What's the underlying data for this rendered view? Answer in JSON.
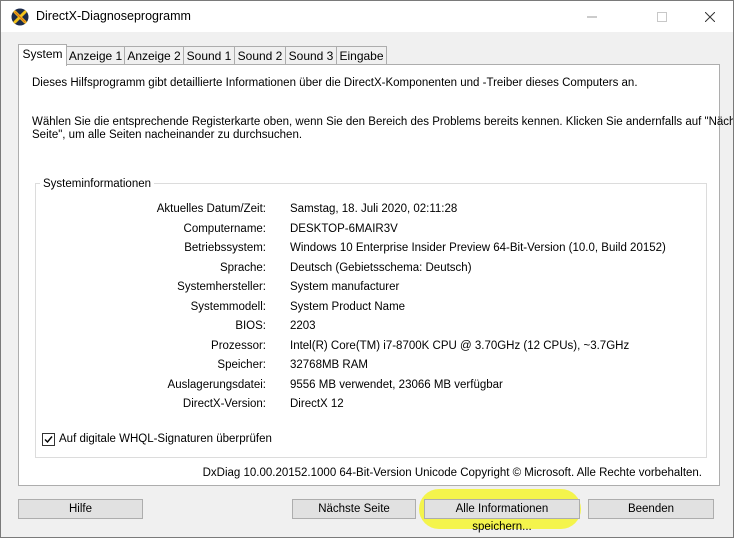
{
  "window": {
    "title": "DirectX-Diagnoseprogramm",
    "minimize_glyph": "—",
    "maximize_glyph": "☐",
    "close_glyph": "✕",
    "icon": "directx-icon"
  },
  "tabs": [
    {
      "label": "System",
      "active": true
    },
    {
      "label": "Anzeige 1"
    },
    {
      "label": "Anzeige 2"
    },
    {
      "label": "Sound 1"
    },
    {
      "label": "Sound 2"
    },
    {
      "label": "Sound 3"
    },
    {
      "label": "Eingabe"
    }
  ],
  "intro": {
    "line1": "Dieses Hilfsprogramm gibt detaillierte Informationen über die DirectX-Komponenten und -Treiber dieses Computers an.",
    "line2": "Wählen Sie die entsprechende Registerkarte oben, wenn Sie den Bereich des Problems bereits kennen. Klicken Sie andernfalls auf \"Nächste",
    "line3": "Seite\", um alle Seiten nacheinander zu durchsuchen."
  },
  "sysinfo": {
    "title": "Systeminformationen",
    "rows": [
      {
        "label": "Aktuelles Datum/Zeit:",
        "value": "Samstag, 18. Juli 2020, 02:11:28"
      },
      {
        "label": "Computername:",
        "value": "DESKTOP-6MAIR3V"
      },
      {
        "label": "Betriebssystem:",
        "value": "Windows 10 Enterprise Insider Preview 64-Bit-Version (10.0, Build 20152)"
      },
      {
        "label": "Sprache:",
        "value": "Deutsch (Gebietsschema: Deutsch)"
      },
      {
        "label": "Systemhersteller:",
        "value": "System manufacturer"
      },
      {
        "label": "Systemmodell:",
        "value": "System Product Name"
      },
      {
        "label": "BIOS:",
        "value": "2203"
      },
      {
        "label": "Prozessor:",
        "value": "Intel(R) Core(TM) i7-8700K CPU @ 3.70GHz (12 CPUs), ~3.7GHz"
      },
      {
        "label": "Speicher:",
        "value": "32768MB RAM"
      },
      {
        "label": "Auslagerungsdatei:",
        "value": "9556 MB verwendet, 23066 MB verfügbar"
      },
      {
        "label": "DirectX-Version:",
        "value": "DirectX 12"
      }
    ],
    "whql_label": "Auf digitale WHQL-Signaturen überprüfen",
    "whql_checked": true
  },
  "copyright": "DxDiag 10.00.20152.1000 64-Bit-Version Unicode Copyright © Microsoft. Alle Rechte vorbehalten.",
  "buttons": {
    "help": "Hilfe",
    "next": "Nächste Seite",
    "save_all": "Alle Informationen speichern...",
    "exit": "Beenden"
  },
  "colors": {
    "highlight": "#f4f43a",
    "panel_bg": "#ffffff",
    "window_bg": "#f0f0f0"
  }
}
